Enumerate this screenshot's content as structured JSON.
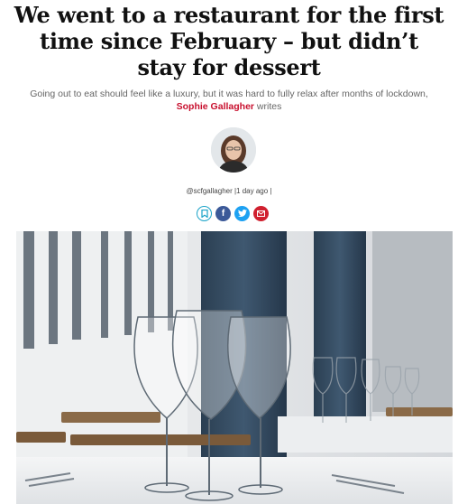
{
  "article": {
    "headline": "We went to a restaurant for the first time since February – but didn’t stay for dessert",
    "standfirst": "Going out to eat should feel like a luxury, but it was hard to fully relax after months of lockdown,",
    "author_name": "Sophie Gallagher",
    "standfirst_suffix": "writes",
    "byline": "@scfgallagher |1 day ago |"
  },
  "share": {
    "icons": [
      "bookmark-icon",
      "facebook-icon",
      "twitter-icon",
      "email-icon"
    ]
  },
  "colors": {
    "author_link": "#c8102e",
    "bookmark": "#1aa3c8",
    "facebook": "#3b5998",
    "twitter": "#1da1f2",
    "email": "#d0202f"
  }
}
